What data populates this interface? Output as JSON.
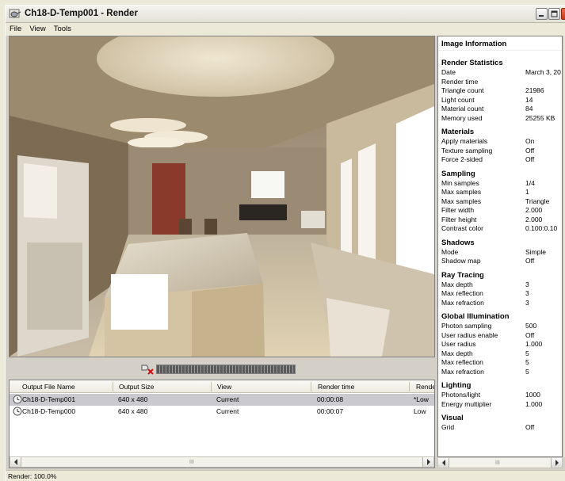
{
  "window": {
    "title": "Ch18-D-Temp001 - Render"
  },
  "menu": [
    "File",
    "View",
    "Tools"
  ],
  "history": {
    "columns": [
      "Output File Name",
      "Output Size",
      "View",
      "Render time",
      "Render"
    ],
    "rows": [
      {
        "name": "Ch18-D-Temp001",
        "size": "640 x 480",
        "view": "Current",
        "time": "00:00:08",
        "preset": "*Low",
        "selected": true
      },
      {
        "name": "Ch18-D-Temp000",
        "size": "640 x 480",
        "view": "Current",
        "time": "00:00:07",
        "preset": "Low",
        "selected": false
      }
    ],
    "scroll_grip": "III"
  },
  "progress": {
    "value": 1.0
  },
  "info": {
    "header": "Image Information",
    "sections": [
      {
        "title": "Render Statistics",
        "rows": [
          [
            "Date",
            "March 3, 20"
          ],
          [
            "Render time",
            ""
          ],
          [
            "Triangle count",
            "21986"
          ],
          [
            "Light count",
            "14"
          ],
          [
            "Material count",
            "84"
          ],
          [
            "Memory used",
            "25255 KB"
          ]
        ]
      },
      {
        "title": "Materials",
        "rows": [
          [
            "Apply materials",
            "On"
          ],
          [
            "Texture sampling",
            "Off"
          ],
          [
            "Force 2-sided",
            "Off"
          ]
        ]
      },
      {
        "title": "Sampling",
        "rows": [
          [
            "Min samples",
            "1/4"
          ],
          [
            "Max samples",
            "1"
          ],
          [
            "Max samples",
            "Triangle"
          ],
          [
            "Filter width",
            "2.000"
          ],
          [
            "Filter height",
            "2.000"
          ],
          [
            "Contrast color",
            "0.100:0.10"
          ]
        ]
      },
      {
        "title": "Shadows",
        "rows": [
          [
            "Mode",
            "Simple"
          ],
          [
            "Shadow map",
            "Off"
          ]
        ]
      },
      {
        "title": "Ray Tracing",
        "rows": [
          [
            "Max depth",
            "3"
          ],
          [
            "Max reflection",
            "3"
          ],
          [
            "Max refraction",
            "3"
          ]
        ]
      },
      {
        "title": "Global Illumination",
        "rows": [
          [
            "Photon sampling",
            "500"
          ],
          [
            "User radius enable",
            "Off"
          ],
          [
            "User radius",
            "1.000"
          ],
          [
            "Max depth",
            "5"
          ],
          [
            "Max reflection",
            "5"
          ],
          [
            "Max refraction",
            "5"
          ]
        ]
      },
      {
        "title": "Lighting",
        "rows": [
          [
            "Photons/light",
            "1000"
          ],
          [
            "Energy multiplier",
            "1.000"
          ]
        ]
      },
      {
        "title": "Visual",
        "rows": [
          [
            "Grid",
            "Off"
          ]
        ]
      }
    ],
    "scroll_grip": "III"
  },
  "status": {
    "text": "Render: 100.0%"
  }
}
